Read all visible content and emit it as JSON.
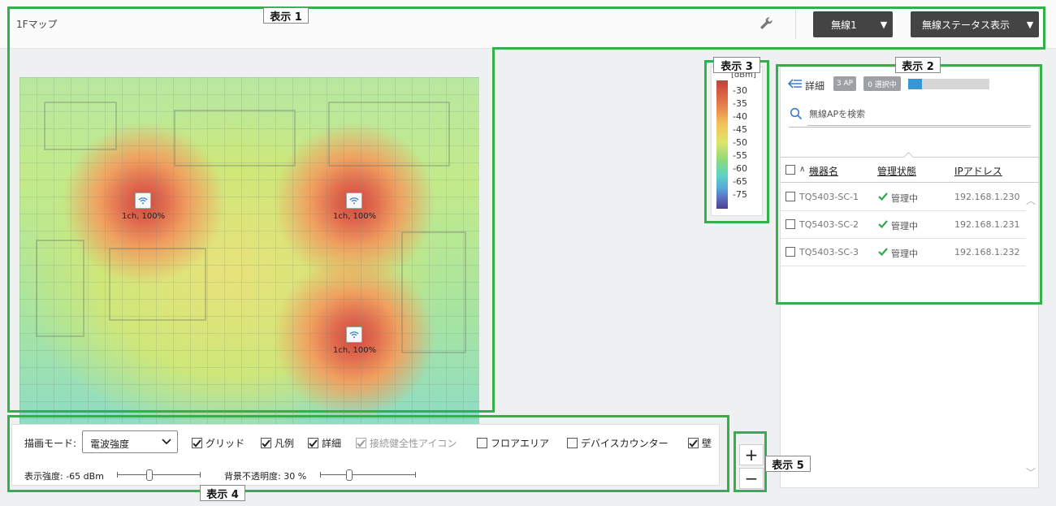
{
  "header": {
    "page_title": "1Fマップ",
    "wireless_dropdown": "無線1",
    "status_dropdown": "無線ステータス表示"
  },
  "map": {
    "access_points": [
      {
        "label": "1ch, 100%"
      },
      {
        "label": "1ch, 100%"
      },
      {
        "label": "1ch, 100%"
      }
    ]
  },
  "legend": {
    "unit": "[dBm]",
    "ticks": [
      "-30",
      "-35",
      "-40",
      "-45",
      "-50",
      "-55",
      "-60",
      "-65",
      "-75"
    ]
  },
  "panel": {
    "detail_label": "詳細",
    "ap_count_badge": "3 AP",
    "selected_badge": "0 選択中",
    "progress": 0.17,
    "search_placeholder": "無線APを検索",
    "columns": {
      "name": "機器名",
      "status": "管理状態",
      "ip": "IPアドレス"
    },
    "rows": [
      {
        "name": "TQ5403-SC-1",
        "status": "管理中",
        "ip": "192.168.1.230"
      },
      {
        "name": "TQ5403-SC-2",
        "status": "管理中",
        "ip": "192.168.1.231"
      },
      {
        "name": "TQ5403-SC-3",
        "status": "管理中",
        "ip": "192.168.1.232"
      }
    ]
  },
  "controls": {
    "mode_label": "描画モード:",
    "mode_value": "電波強度",
    "options": [
      {
        "label": "グリッド",
        "checked": true,
        "disabled": false
      },
      {
        "label": "凡例",
        "checked": true,
        "disabled": false
      },
      {
        "label": "詳細",
        "checked": true,
        "disabled": false
      },
      {
        "label": "接続健全性アイコン",
        "checked": true,
        "disabled": true
      },
      {
        "label": "フロアエリア",
        "checked": false,
        "disabled": false
      },
      {
        "label": "デバイスカウンター",
        "checked": false,
        "disabled": false
      },
      {
        "label": "壁",
        "checked": true,
        "disabled": false
      }
    ],
    "strength_label": "表示強度: -65 dBm",
    "strength_value": -65,
    "opacity_label": "背景不透明度: 30 %",
    "opacity_value": 30
  },
  "zoom": {
    "in": "+",
    "out": "−"
  },
  "annotations": [
    "表示 1",
    "表示 2",
    "表示 3",
    "表示 4",
    "表示 5"
  ],
  "colors": {
    "callout": "#33b04a",
    "accent": "#3a96d3",
    "ok_green": "#2ea84a"
  }
}
